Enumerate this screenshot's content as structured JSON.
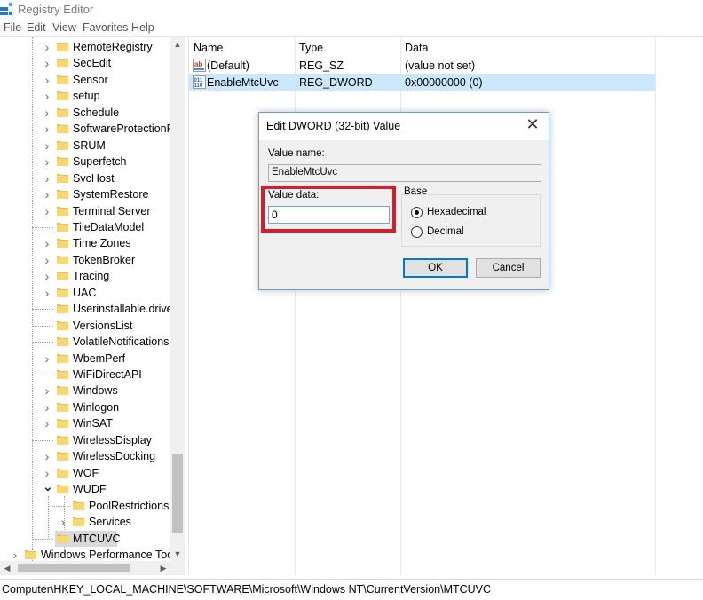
{
  "window": {
    "title": "Registry Editor",
    "icon": "registry-editor-icon"
  },
  "menu": [
    "File",
    "Edit",
    "View",
    "Favorites",
    "Help"
  ],
  "tree": {
    "items": [
      {
        "label": "RemoteRegistry",
        "expand": true
      },
      {
        "label": "SecEdit",
        "expand": true
      },
      {
        "label": "Sensor",
        "expand": true
      },
      {
        "label": "setup",
        "expand": true
      },
      {
        "label": "Schedule",
        "expand": true
      },
      {
        "label": "SoftwareProtectionPl",
        "expand": true
      },
      {
        "label": "SRUM",
        "expand": true
      },
      {
        "label": "Superfetch",
        "expand": true
      },
      {
        "label": "SvcHost",
        "expand": true
      },
      {
        "label": "SystemRestore",
        "expand": true
      },
      {
        "label": "Terminal Server",
        "expand": true
      },
      {
        "label": "TileDataModel",
        "expand": false
      },
      {
        "label": "Time Zones",
        "expand": true
      },
      {
        "label": "TokenBroker",
        "expand": true
      },
      {
        "label": "Tracing",
        "expand": true
      },
      {
        "label": "UAC",
        "expand": true
      },
      {
        "label": "Userinstallable.driver",
        "expand": false
      },
      {
        "label": "VersionsList",
        "expand": false
      },
      {
        "label": "VolatileNotifications",
        "expand": false
      },
      {
        "label": "WbemPerf",
        "expand": true
      },
      {
        "label": "WiFiDirectAPI",
        "expand": false
      },
      {
        "label": "Windows",
        "expand": true
      },
      {
        "label": "Winlogon",
        "expand": true
      },
      {
        "label": "WinSAT",
        "expand": true
      },
      {
        "label": "WirelessDisplay",
        "expand": false
      },
      {
        "label": "WirelessDocking",
        "expand": true
      },
      {
        "label": "WOF",
        "expand": true
      },
      {
        "label": "WUDF",
        "expand": "open"
      },
      {
        "label": "PoolRestrictions",
        "expand": false
      },
      {
        "label": "Services",
        "expand": true
      },
      {
        "label": "MTCUVC",
        "expand": false,
        "selected": true
      },
      {
        "label": "Windows Performance Tool",
        "expand": true
      }
    ]
  },
  "list": {
    "columns": [
      "Name",
      "Type",
      "Data"
    ],
    "rows": [
      {
        "name": "(Default)",
        "type": "REG_SZ",
        "data": "(value not set)",
        "icon": "string-value-icon"
      },
      {
        "name": "EnableMtcUvc",
        "type": "REG_DWORD",
        "data": "0x00000000 (0)",
        "icon": "binary-value-icon",
        "selected": true
      }
    ]
  },
  "statusbar": {
    "path": "Computer\\HKEY_LOCAL_MACHINE\\SOFTWARE\\Microsoft\\Windows NT\\CurrentVersion\\MTCUVC"
  },
  "dialog": {
    "title": "Edit DWORD (32-bit) Value",
    "value_name_label": "Value name:",
    "value_name": "EnableMtcUvc",
    "value_data_label": "Value data:",
    "value_data": "0",
    "base_label": "Base",
    "hex_label": "Hexadecimal",
    "dec_label": "Decimal",
    "base_selected": "Hexadecimal",
    "ok_label": "OK",
    "cancel_label": "Cancel",
    "highlight_color": "#d0202e"
  }
}
